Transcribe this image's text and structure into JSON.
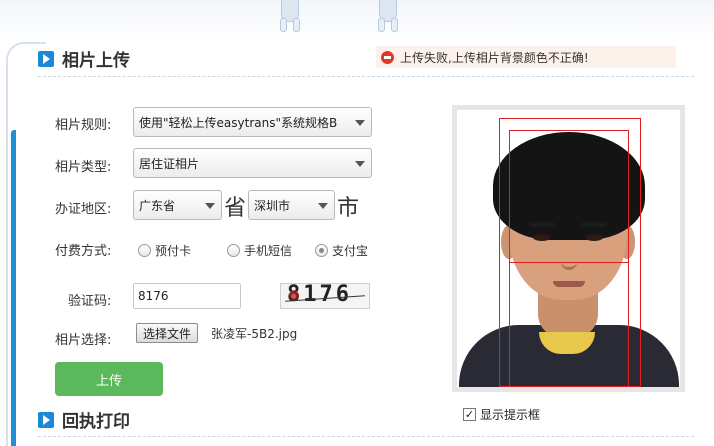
{
  "section_upload": {
    "title": "相片上传"
  },
  "section_receipt": {
    "title": "回执打印"
  },
  "error": {
    "message": "上传失败,上传相片背景颜色不正确!"
  },
  "form": {
    "rule_label": "相片规则:",
    "rule_value": "使用\"轻松上传easytrans\"系统规格B",
    "type_label": "相片类型:",
    "type_value": "居住证相片",
    "region_label": "办证地区:",
    "province_value": "广东省",
    "province_suffix": "省",
    "city_value": "深圳市",
    "city_suffix": "市",
    "payment_label": "付费方式:",
    "payment_options": [
      "预付卡",
      "手机短信",
      "支付宝"
    ],
    "payment_selected": "支付宝",
    "captcha_label": "验证码:",
    "captcha_input_value": "8176",
    "captcha_image_text": "8176",
    "photo_label": "相片选择:",
    "file_button_label": "选择文件",
    "file_name": "张凌军-5B2.jpg",
    "upload_button_label": "上传"
  },
  "receipt": {
    "show_hint_label": "显示提示框",
    "show_hint_checked": true
  },
  "colors": {
    "accent_blue": "#1b8ad6",
    "upload_green": "#5cb85c",
    "error_red": "#e0372b",
    "guide_red": "#e02020"
  }
}
